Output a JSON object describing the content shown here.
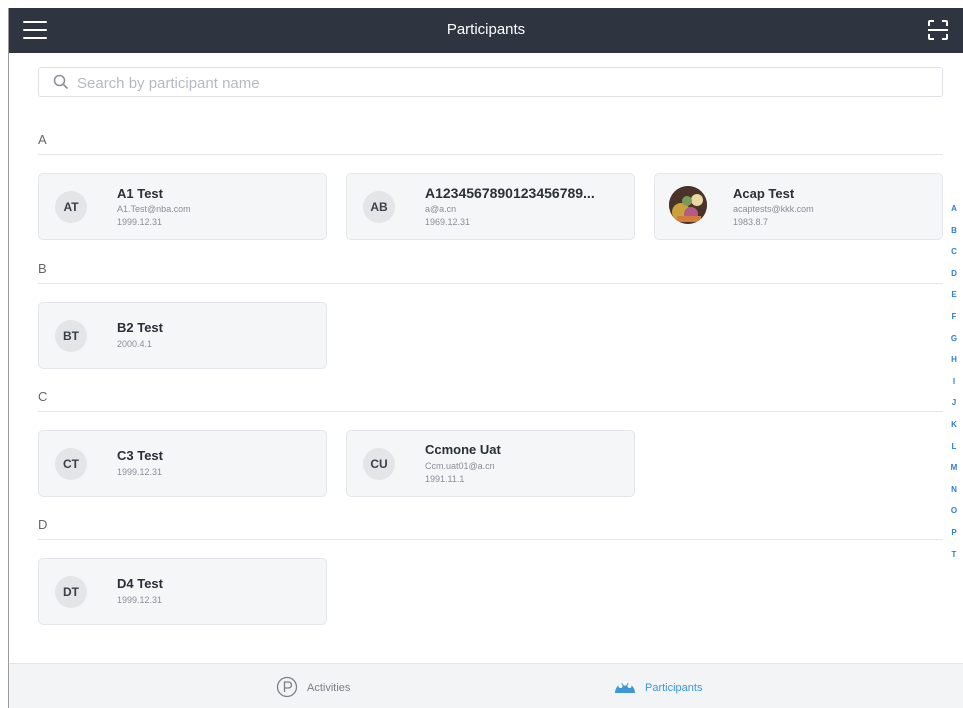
{
  "header": {
    "title": "Participants"
  },
  "search": {
    "placeholder": "Search by participant name"
  },
  "sections": [
    {
      "letter": "A",
      "participants": [
        {
          "initials": "AT",
          "name": "A1 Test",
          "email": "A1.Test@nba.com",
          "date": "1999.12.31"
        },
        {
          "initials": "AB",
          "name": "A1234567890123456789...",
          "email": "a@a.cn",
          "date": "1969.12.31"
        },
        {
          "initials": "",
          "name": "Acap Test",
          "email": "acaptests@kkk.com",
          "date": "1983.8.7"
        }
      ]
    },
    {
      "letter": "B",
      "participants": [
        {
          "initials": "BT",
          "name": "B2 Test",
          "date": "2000.4.1"
        }
      ]
    },
    {
      "letter": "C",
      "participants": [
        {
          "initials": "CT",
          "name": "C3 Test",
          "date": "1999.12.31"
        },
        {
          "initials": "CU",
          "name": "Ccmone Uat",
          "email": "Ccm.uat01@a.cn",
          "date": "1991.11.1"
        }
      ]
    },
    {
      "letter": "D",
      "participants": [
        {
          "initials": "DT",
          "name": "D4 Test",
          "date": "1999.12.31"
        }
      ]
    }
  ],
  "alpha_index": [
    "A",
    "B",
    "C",
    "D",
    "E",
    "F",
    "G",
    "H",
    "I",
    "J",
    "K",
    "L",
    "M",
    "N",
    "O",
    "P",
    "T"
  ],
  "tabs": [
    {
      "label": "Activities",
      "icon": "activities-icon",
      "active": false
    },
    {
      "label": "Participants",
      "icon": "participants-icon",
      "active": true
    }
  ],
  "colors": {
    "header": "#2e3440",
    "accent": "#3b97d8",
    "card": "#f4f6f8"
  }
}
